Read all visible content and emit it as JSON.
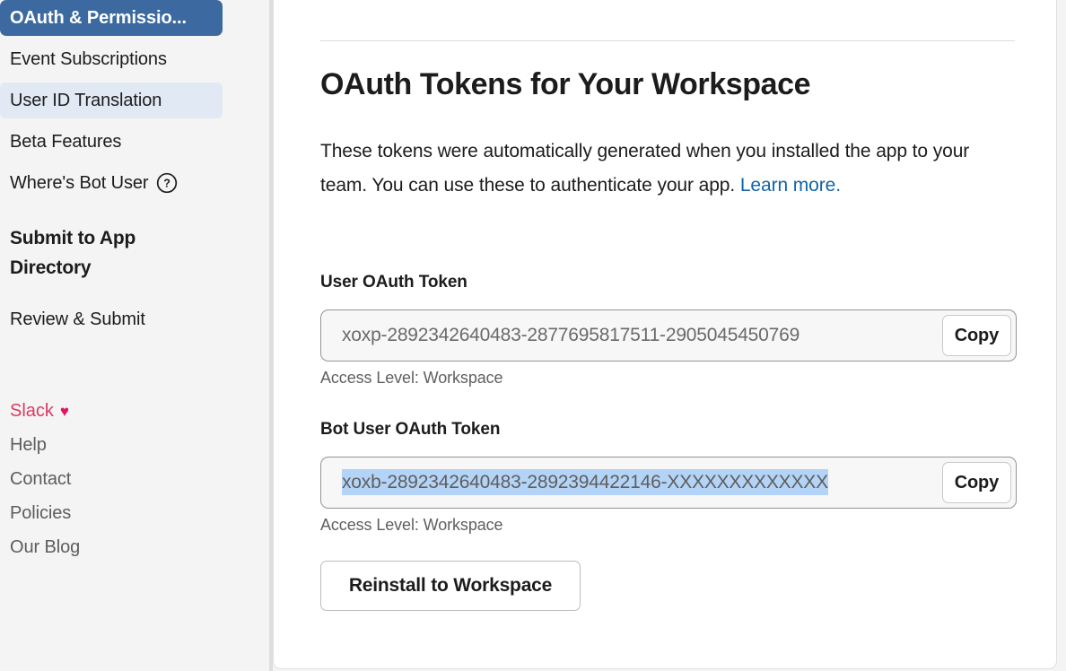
{
  "sidebar": {
    "nav_items": [
      {
        "label": "OAuth & Permissio...",
        "state": "active",
        "has_help_icon": false
      },
      {
        "label": "Event Subscriptions",
        "state": "default",
        "has_help_icon": false
      },
      {
        "label": "User ID Translation",
        "state": "hovered",
        "has_help_icon": false
      },
      {
        "label": "Beta Features",
        "state": "default",
        "has_help_icon": false
      },
      {
        "label": "Where's Bot User",
        "state": "default",
        "has_help_icon": true
      }
    ],
    "section_heading": "Submit to App Directory",
    "section_items": [
      {
        "label": "Review & Submit"
      }
    ],
    "brand": {
      "label": "Slack",
      "heart_glyph": "♥"
    },
    "footer_links": [
      {
        "label": "Help"
      },
      {
        "label": "Contact"
      },
      {
        "label": "Policies"
      },
      {
        "label": "Our Blog"
      }
    ],
    "colors": {
      "active_background": "#3c6aa0",
      "hover_background": "#e1eaf4",
      "brand_pink": "#e01563",
      "background": "#f4f4f4"
    }
  },
  "main": {
    "page_title": "OAuth Tokens for Your Workspace",
    "intro_text": "These tokens were automatically generated when you installed the app to your team. You can use these to authenticate your app. ",
    "intro_link_text": "Learn more.",
    "fields": [
      {
        "label": "User OAuth Token",
        "value": "xoxp-2892342640483-2877695817511-2905045450769",
        "selected": false,
        "copy_label": "Copy",
        "access_level": "Access Level: Workspace"
      },
      {
        "label": "Bot User OAuth Token",
        "value": "xoxb-2892342640483-2892394422146-XXXXXXXXXXXXX",
        "selected": true,
        "copy_label": "Copy",
        "access_level": "Access Level: Workspace"
      }
    ],
    "reinstall_label": "Reinstall to Workspace",
    "colors": {
      "link": "#1264a3",
      "selection_highlight": "#b4d4f7",
      "input_background": "#f7f7f7"
    }
  }
}
